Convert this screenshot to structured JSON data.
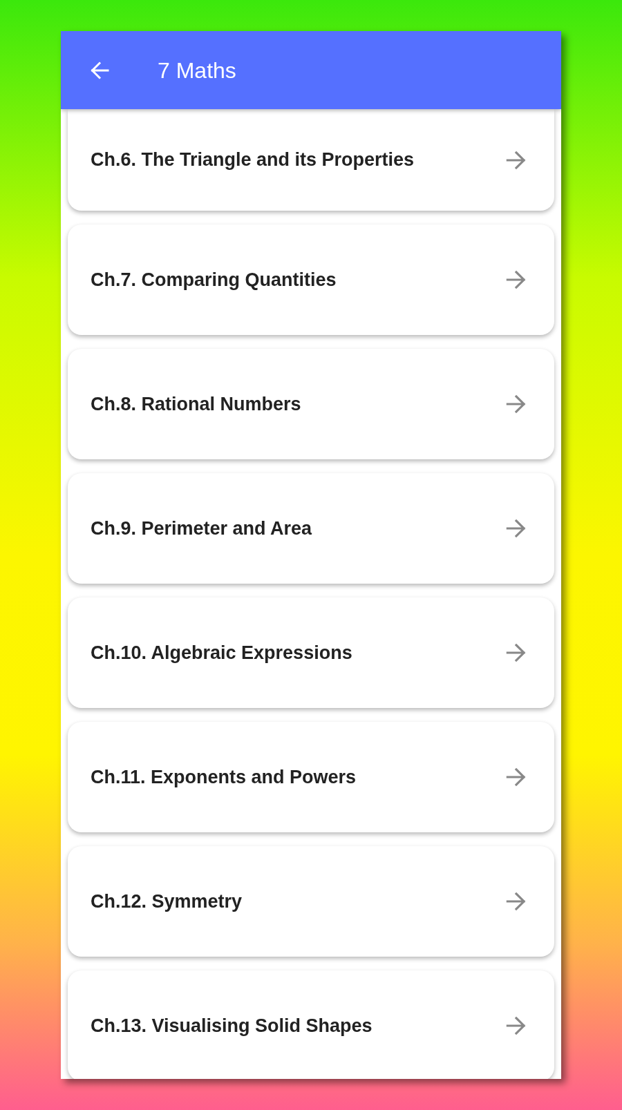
{
  "app_bar": {
    "title": "7 Maths"
  },
  "chapters": [
    {
      "title": "Ch.6. The Triangle and its Properties"
    },
    {
      "title": "Ch.7. Comparing Quantities"
    },
    {
      "title": "Ch.8. Rational Numbers"
    },
    {
      "title": "Ch.9. Perimeter and Area"
    },
    {
      "title": "Ch.10. Algebraic Expressions"
    },
    {
      "title": "Ch.11. Exponents and Powers"
    },
    {
      "title": "Ch.12. Symmetry"
    },
    {
      "title": "Ch.13. Visualising Solid Shapes"
    }
  ]
}
